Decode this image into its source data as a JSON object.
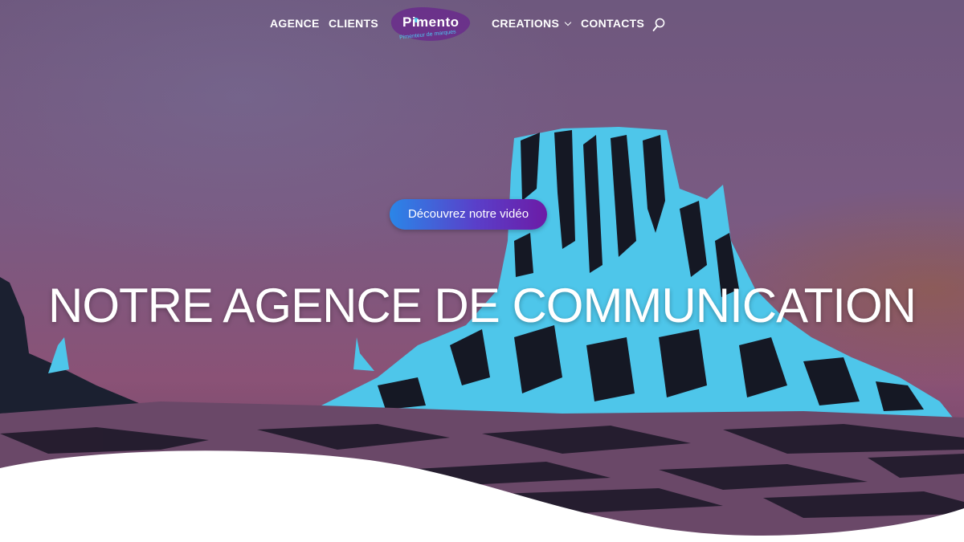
{
  "nav": {
    "items": [
      {
        "label": "AGENCE"
      },
      {
        "label": "CLIENTS"
      },
      {
        "label": "CREATIONS"
      },
      {
        "label": "CONTACTS"
      }
    ],
    "search_icon": "search-icon"
  },
  "logo": {
    "name": "Pimento",
    "tagline": "Pimenteur de marques"
  },
  "hero": {
    "cta_label": "Découvrez notre vidéo",
    "headline": "NOTRE AGENCE DE COMMUNICATION"
  },
  "colors": {
    "accent_blue": "#2a86e8",
    "accent_purple": "#6c1ba6",
    "mesa_cyan": "#4ec6ea",
    "sky": "#7a5a82"
  }
}
